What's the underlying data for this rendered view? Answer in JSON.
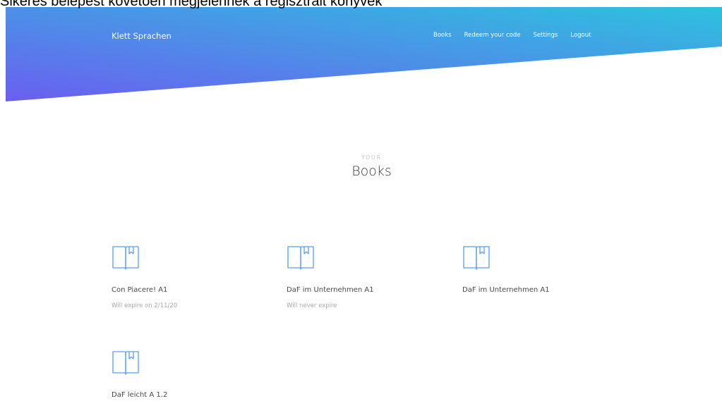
{
  "caption": "Sikeres belépést követően megjelennek a regisztrált könyvek",
  "header": {
    "brand": "Klett Sprachen",
    "nav": [
      {
        "label": "Books"
      },
      {
        "label": "Redeem your code"
      },
      {
        "label": "Settings"
      },
      {
        "label": "Logout"
      }
    ],
    "gradient_start": "#6a5ff0",
    "gradient_end": "#2dc2de"
  },
  "section": {
    "kicker": "YOUR",
    "title": "Books"
  },
  "books": [
    {
      "icon": "book-icon",
      "title": "Con Piacere! A1",
      "expiry": "Will expire on 2/11/20"
    },
    {
      "icon": "book-icon",
      "title": "DaF im Unternehmen A1",
      "expiry": "Will never expire"
    },
    {
      "icon": "book-icon",
      "title": "DaF im Unternehmen A1",
      "expiry": ""
    },
    {
      "icon": "book-icon",
      "title": "DaF leicht A 1.2",
      "expiry": ""
    }
  ],
  "colors": {
    "icon_stroke": "#5b9ee8",
    "title_text": "#4a4a4a",
    "muted_text": "#aaaaaa"
  }
}
